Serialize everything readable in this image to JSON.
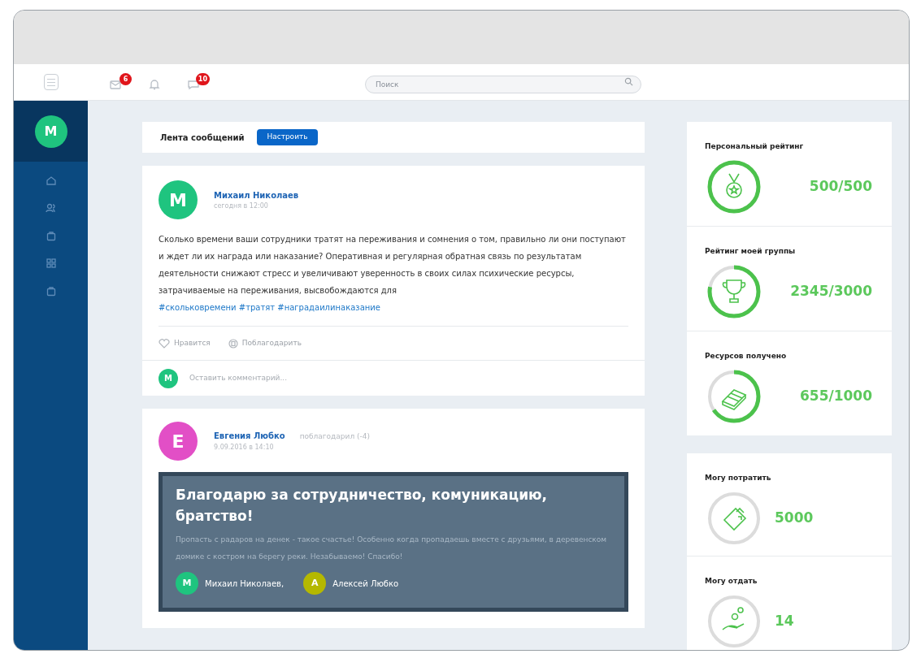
{
  "header": {
    "badges": [
      {
        "kind": "mail",
        "count": "6"
      },
      {
        "kind": "bell"
      },
      {
        "kind": "chat",
        "count": "10"
      }
    ],
    "search": {
      "placeholder": "Поиск"
    }
  },
  "sidebar": {
    "avatar": "М",
    "items": [
      {
        "kind": "home"
      },
      {
        "kind": "users"
      },
      {
        "kind": "bag"
      },
      {
        "kind": "grid"
      },
      {
        "kind": "bag"
      }
    ]
  },
  "feed": {
    "title": "Лента сообщений",
    "button": "Настроить"
  },
  "posts": [
    {
      "avatar": "М",
      "color": "#1fc47f",
      "author": "Михаил Николаев",
      "time": "сегодня в 12:00",
      "text": "Сколько времени ваши сотрудники тратят на переживания и сомнения о том, правильно ли они поступают и ждет ли их награда или наказание? Оперативная и регулярная обратная связь по результатам деятельности снижают стресс и увеличивают уверенность в своих силах психические ресурсы, затрачиваемые на переживания, высвобождаются для",
      "tags": "#скольковремени #тратят #наградаилинаказание",
      "actions": [
        "Нравится",
        "Поблагодарить"
      ],
      "comment_avatar": "М",
      "comment_placeholder": "Оставить комментарий..."
    },
    {
      "avatar": "Е",
      "color": "#e24fc6",
      "author": "Евгения Любко",
      "action": "поблагодарил (-4)",
      "time": "9.09.2016 в 14:10",
      "card": {
        "title": "Благодарю за сотрудничество, комуникацию, братство!",
        "text": "Пропасть с радаров на денек - такое счастье! Особенно когда пропадаешь вместе с друзьями, в деревенском домике с костром на берегу реки. Незабываемо! Спасибо!",
        "people": [
          {
            "avatar": "М",
            "name": "Михаил Николаев,",
            "color": "#1fc47f"
          },
          {
            "avatar": "А",
            "name": "Алексей Любко",
            "color": "#b5b800"
          }
        ]
      }
    }
  ],
  "stats": [
    {
      "title": "Персональный рейтинг",
      "value": "500/500"
    },
    {
      "title": "Рейтинг моей группы",
      "value": "2345/3000"
    },
    {
      "title": "Ресурсов получено",
      "value": "655/1000"
    }
  ],
  "wallet": [
    {
      "title": "Могу потратить",
      "value": "5000"
    },
    {
      "title": "Могу отдать",
      "value": "14"
    }
  ]
}
